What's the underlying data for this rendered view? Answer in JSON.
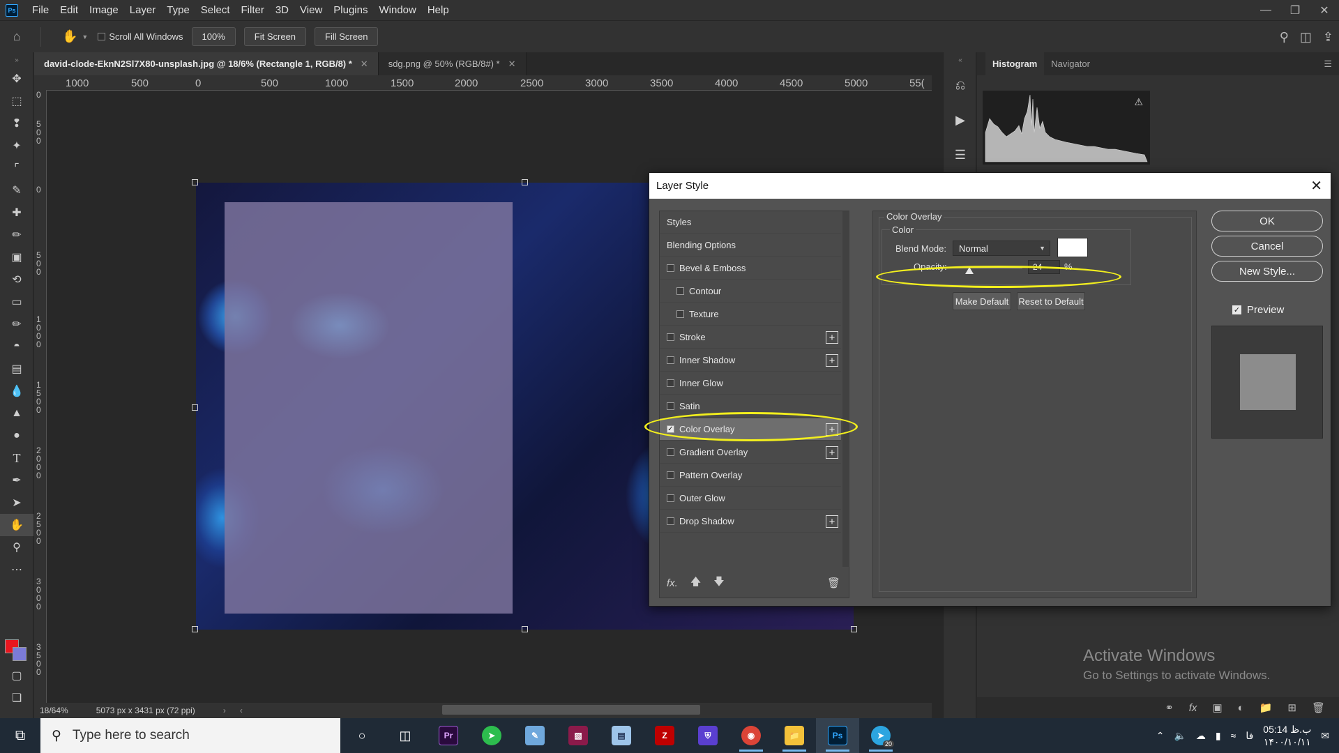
{
  "menubar": {
    "logo": "Ps",
    "items": [
      "File",
      "Edit",
      "Image",
      "Layer",
      "Type",
      "Select",
      "Filter",
      "3D",
      "View",
      "Plugins",
      "Window",
      "Help"
    ]
  },
  "options": {
    "scroll_all_windows": "Scroll All Windows",
    "zoom": "100%",
    "fit_screen": "Fit Screen",
    "fill_screen": "Fill Screen"
  },
  "tabs": [
    {
      "label": "david-clode-EknN2Sl7X80-unsplash.jpg @ 18/6% (Rectangle 1, RGB/8) *",
      "active": true
    },
    {
      "label": "sdg.png @ 50% (RGB/8#) *",
      "active": false
    }
  ],
  "ruler": {
    "h_labels": [
      "1000",
      "500",
      "0",
      "500",
      "1000",
      "1500",
      "2000",
      "2500",
      "3000",
      "3500",
      "4000",
      "4500",
      "5000",
      "55("
    ],
    "v_labels": [
      "0",
      "500",
      "0",
      "500",
      "1000",
      "1500",
      "2000",
      "2500",
      "3000",
      "3500"
    ]
  },
  "status": {
    "zoom": "18/64%",
    "doc_info": "5073 px x 3431 px (72 ppi)"
  },
  "right_panel": {
    "tabs": [
      "Histogram",
      "Navigator"
    ],
    "activate_title": "Activate Windows",
    "activate_sub": "Go to Settings to activate Windows."
  },
  "dialog": {
    "title": "Layer Style",
    "styles_header": "Styles",
    "blending_options": "Blending Options",
    "styles": [
      {
        "label": "Bevel & Emboss",
        "checked": false,
        "plus": false,
        "indent": false
      },
      {
        "label": "Contour",
        "checked": false,
        "plus": false,
        "indent": true
      },
      {
        "label": "Texture",
        "checked": false,
        "plus": false,
        "indent": true
      },
      {
        "label": "Stroke",
        "checked": false,
        "plus": true,
        "indent": false
      },
      {
        "label": "Inner Shadow",
        "checked": false,
        "plus": true,
        "indent": false
      },
      {
        "label": "Inner Glow",
        "checked": false,
        "plus": false,
        "indent": false
      },
      {
        "label": "Satin",
        "checked": false,
        "plus": false,
        "indent": false
      },
      {
        "label": "Color Overlay",
        "checked": true,
        "plus": true,
        "indent": false,
        "selected": true
      },
      {
        "label": "Gradient Overlay",
        "checked": false,
        "plus": true,
        "indent": false
      },
      {
        "label": "Pattern Overlay",
        "checked": false,
        "plus": false,
        "indent": false
      },
      {
        "label": "Outer Glow",
        "checked": false,
        "plus": false,
        "indent": false
      },
      {
        "label": "Drop Shadow",
        "checked": false,
        "plus": true,
        "indent": false
      }
    ],
    "footer_fx": "fx.",
    "section_title": "Color Overlay",
    "group_title": "Color",
    "blend_mode_label": "Blend Mode:",
    "blend_mode_value": "Normal",
    "overlay_color": "#ffffff",
    "opacity_label": "Opacity:",
    "opacity_value": "24",
    "opacity_unit": "%",
    "make_default": "Make Default",
    "reset_default": "Reset to Default",
    "ok": "OK",
    "cancel": "Cancel",
    "new_style": "New Style...",
    "preview_label": "Preview",
    "preview_checked": true
  },
  "taskbar": {
    "search_placeholder": "Type here to search",
    "time": "05:14 ب.ظ",
    "date": "۱۴۰۰/۱۰/۱۱",
    "lang": "فا",
    "telegram_badge": "20"
  },
  "colors": {
    "foreground": "#e8161f",
    "background": "#7b7bd8",
    "highlight": "#f3ef1d"
  }
}
